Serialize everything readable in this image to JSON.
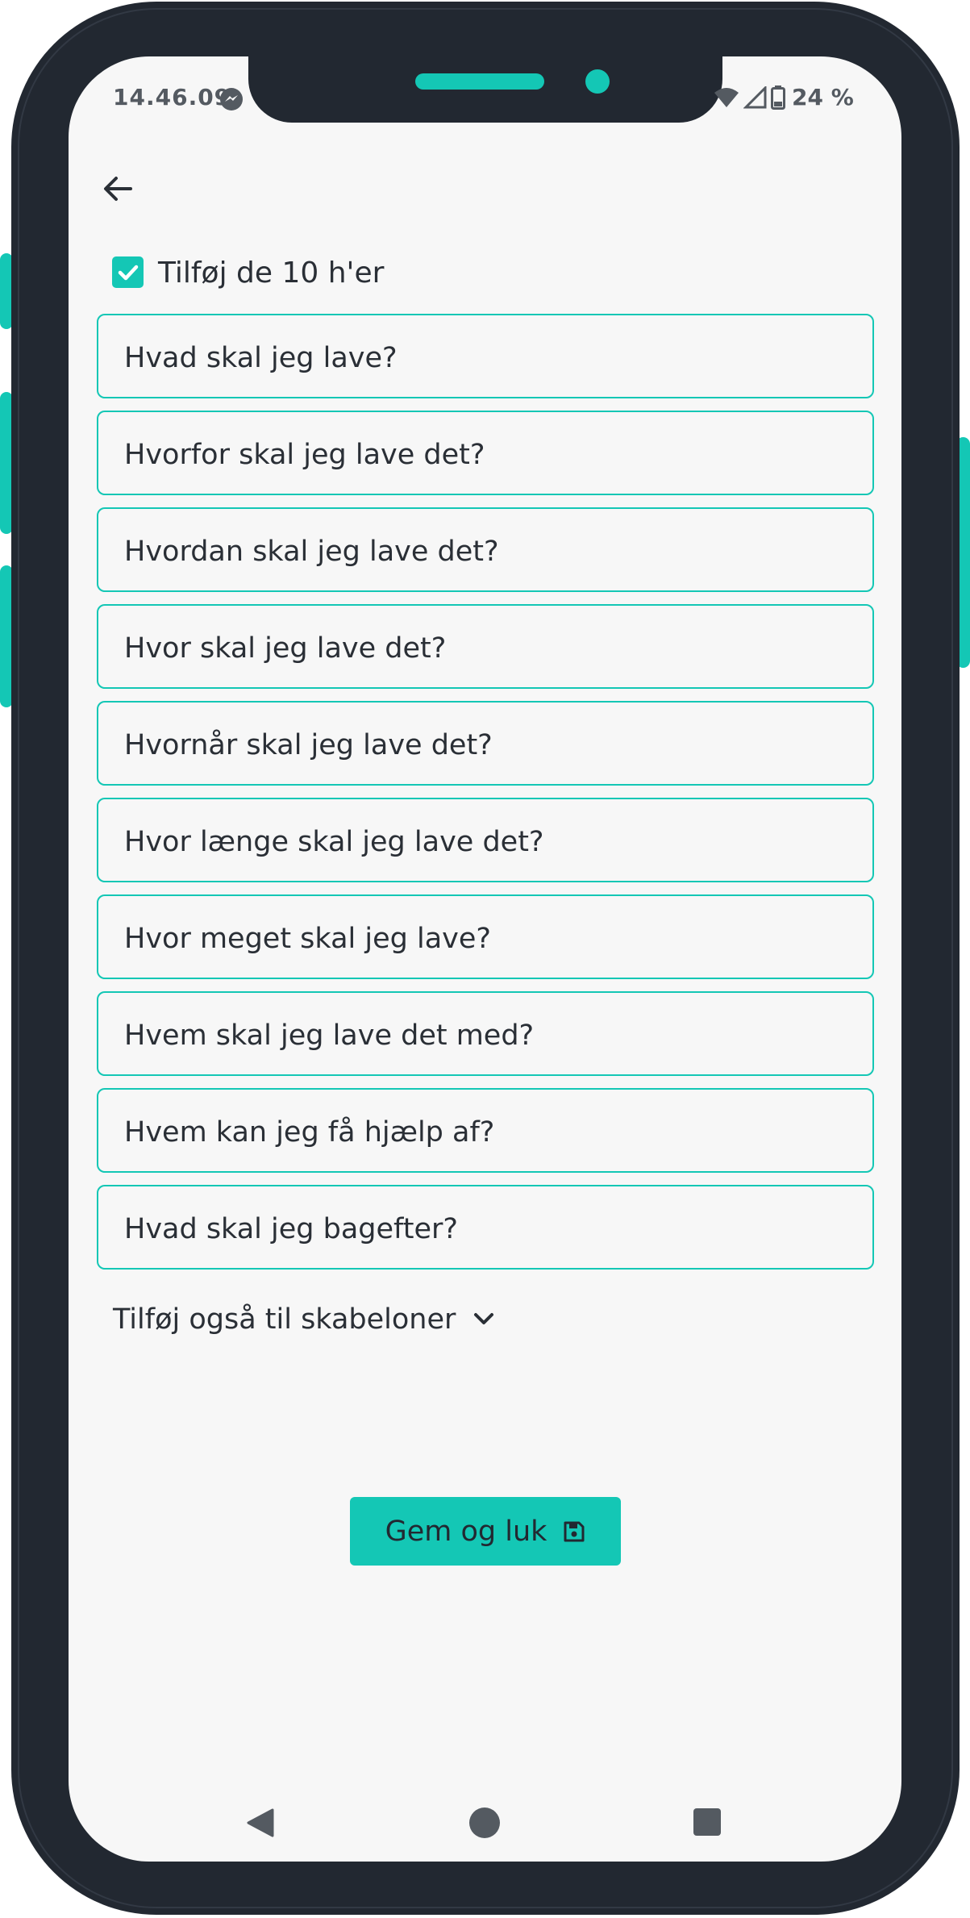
{
  "status_bar": {
    "time": "14.46.09",
    "battery": "24 %"
  },
  "form": {
    "checkbox_label": "Tilføj de 10 h'er",
    "checkbox_checked": true,
    "questions": [
      "Hvad skal jeg lave?",
      "Hvorfor skal jeg lave det?",
      "Hvordan skal jeg lave det?",
      "Hvor skal jeg lave det?",
      "Hvornår skal jeg lave det?",
      "Hvor længe skal jeg lave det?",
      "Hvor meget skal jeg lave?",
      "Hvem skal jeg lave det med?",
      "Hvem kan jeg få hjælp af?",
      "Hvad skal jeg bagefter?"
    ],
    "templates_toggle_label": "Tilføj også til skabeloner",
    "save_label": "Gem og luk"
  },
  "icons": {
    "back": "arrow-left-icon",
    "checkbox": "check-icon",
    "templates": "chevron-down-icon",
    "save": "floppy-disk-icon",
    "nav_back": "triangle-back-icon",
    "nav_home": "circle-home-icon",
    "nav_recent": "square-recent-icon"
  },
  "colors": {
    "accent": "#14c7b5",
    "frame": "#222831",
    "screen": "#f7f7f7",
    "text": "#2a2f36"
  }
}
